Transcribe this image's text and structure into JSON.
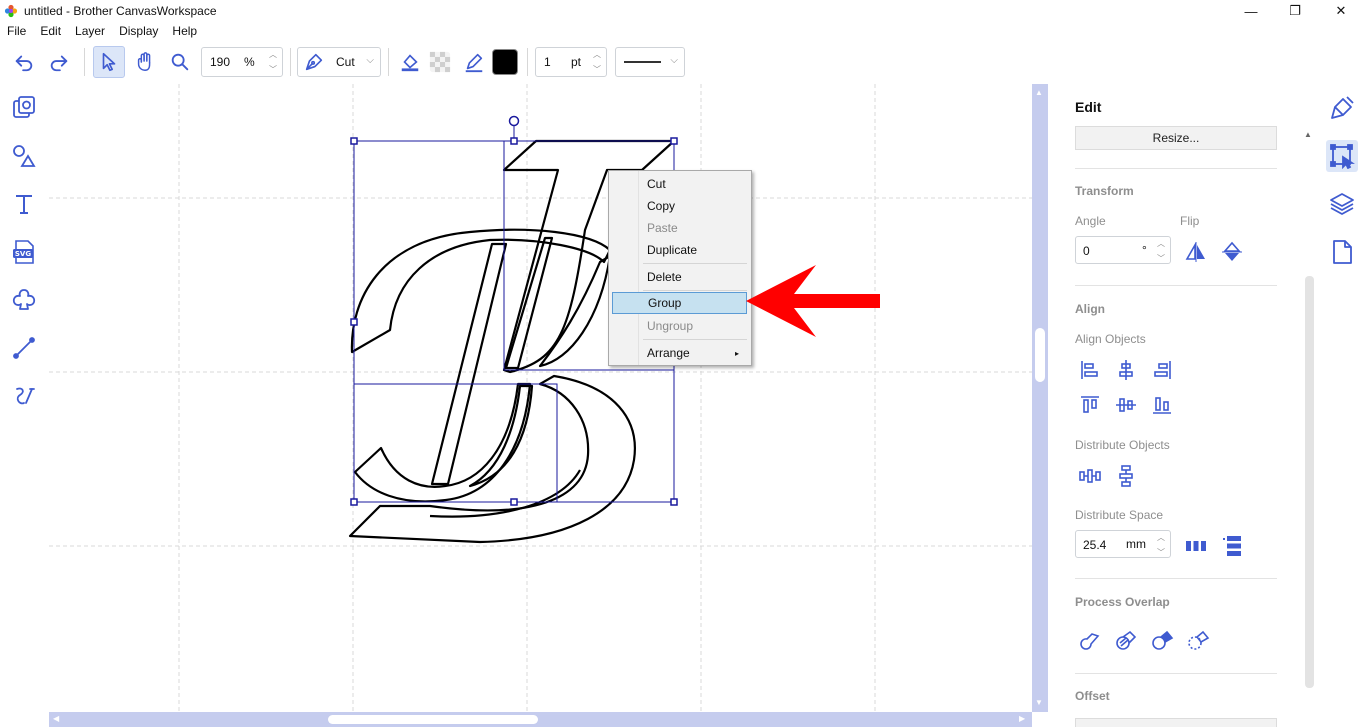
{
  "window": {
    "title": "untitled - Brother CanvasWorkspace",
    "minimize_glyph": "—",
    "maximize_glyph": "❐",
    "close_glyph": "✕"
  },
  "menubar": {
    "items": [
      {
        "label": "File"
      },
      {
        "label": "Edit"
      },
      {
        "label": "Layer"
      },
      {
        "label": "Display"
      },
      {
        "label": "Help"
      }
    ]
  },
  "toolbar": {
    "zoom_value": "190",
    "zoom_unit": "%",
    "cut_mode_label": "Cut",
    "line_width_value": "1",
    "line_width_unit": "pt",
    "line_color": "#000000",
    "icons": [
      "undo-icon",
      "redo-icon",
      "select-icon",
      "hand-icon",
      "zoom-icon",
      "pen-icon",
      "fill-icon",
      "transparent-icon",
      "line-color-icon"
    ]
  },
  "leftbar": {
    "icons": [
      "pattern-icon",
      "shapes-icon",
      "text-icon",
      "svg-icon",
      "trace-icon",
      "line-icon",
      "freehand-icon"
    ],
    "svg_badge": "SVG"
  },
  "context_menu": {
    "items": [
      {
        "label": "Cut",
        "enabled": true
      },
      {
        "label": "Copy",
        "enabled": true
      },
      {
        "label": "Paste",
        "enabled": false
      },
      {
        "label": "Duplicate",
        "enabled": true
      },
      {
        "label": "Delete",
        "enabled": true
      },
      {
        "label": "Group",
        "enabled": true,
        "highlighted": true
      },
      {
        "label": "Ungroup",
        "enabled": false
      },
      {
        "label": "Arrange",
        "enabled": true,
        "submenu": true
      }
    ],
    "submenu_glyph": "▸"
  },
  "edit_panel": {
    "title": "Edit",
    "resize_button": "Resize...",
    "transform": {
      "heading": "Transform",
      "angle_label": "Angle",
      "angle_value": "0",
      "angle_unit": "°",
      "flip_label": "Flip"
    },
    "align": {
      "heading": "Align",
      "align_objects_label": "Align Objects",
      "distribute_objects_label": "Distribute Objects",
      "distribute_space_label": "Distribute Space",
      "distribute_space_value": "25.4",
      "distribute_space_unit": "mm"
    },
    "process_overlap": {
      "heading": "Process Overlap"
    },
    "offset": {
      "heading": "Offset"
    }
  },
  "farright": {
    "icons": [
      "brush-icon",
      "edit-select-icon",
      "layers-icon",
      "page-icon"
    ],
    "active": "edit-select-icon"
  },
  "colors": {
    "accent": "#3f5bd0",
    "selection": "#1a1a9e",
    "scrollbar": "#c5ccee",
    "menu_highlight": "#c6e1f0",
    "annotation_red": "#ff0000"
  }
}
